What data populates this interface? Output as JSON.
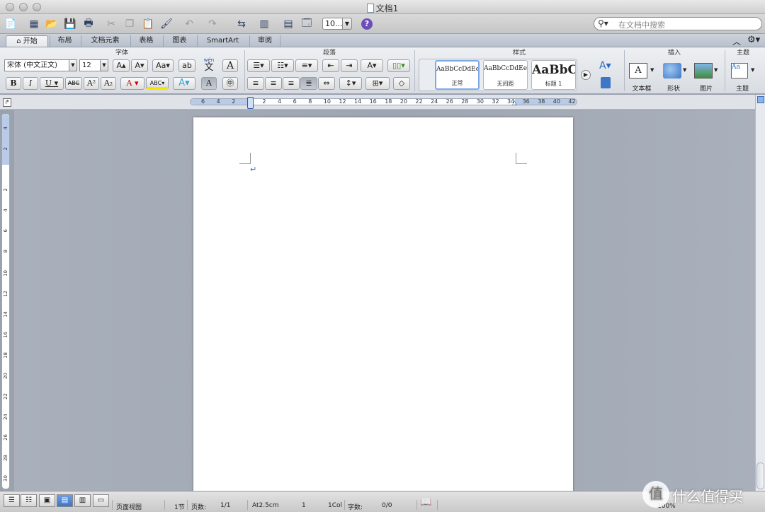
{
  "window": {
    "title": "文档1"
  },
  "toolbar": {
    "zoom": "10...",
    "search_placeholder": "在文档中搜索",
    "help": "?"
  },
  "tabs": [
    "开始",
    "布局",
    "文档元素",
    "表格",
    "图表",
    "SmartArt",
    "审阅"
  ],
  "ribbon": {
    "groups": {
      "font": "字体",
      "paragraph": "段落",
      "styles": "样式",
      "insert": "插入",
      "theme": "主题"
    },
    "font_name": "宋体 (中文正文)",
    "font_size": "12",
    "phonetic_top": "wén",
    "phonetic_bottom": "文",
    "styles": [
      {
        "sample": "AaBbCcDdEe",
        "name": "正常"
      },
      {
        "sample": "AaBbCcDdEe",
        "name": "无间距"
      },
      {
        "sample": "AaBbC",
        "name": "标题 1"
      }
    ],
    "insert_items": [
      "文本框",
      "形状",
      "图片"
    ],
    "theme_label": "主题"
  },
  "ruler": {
    "h_ticks": [
      "6",
      "4",
      "2",
      "",
      "2",
      "4",
      "6",
      "8",
      "10",
      "12",
      "14",
      "16",
      "18",
      "20",
      "22",
      "24",
      "26",
      "28",
      "30",
      "32",
      "34",
      "36",
      "38",
      "40",
      "42"
    ],
    "v_ticks": [
      "4",
      "2",
      "",
      "2",
      "4",
      "6",
      "8",
      "10",
      "12",
      "14",
      "16",
      "18",
      "20",
      "22",
      "24",
      "26",
      "28",
      "30"
    ]
  },
  "status": {
    "view": "页面视图",
    "section": "1节",
    "pages_label": "页数:",
    "pages_value": "1/1",
    "at": "At2.5cm",
    "ln": "1",
    "col": "1Col",
    "words_label": "字数:",
    "words_value": "0/0",
    "zoom": "100%"
  },
  "watermark": {
    "text": "值 什么值得买"
  }
}
